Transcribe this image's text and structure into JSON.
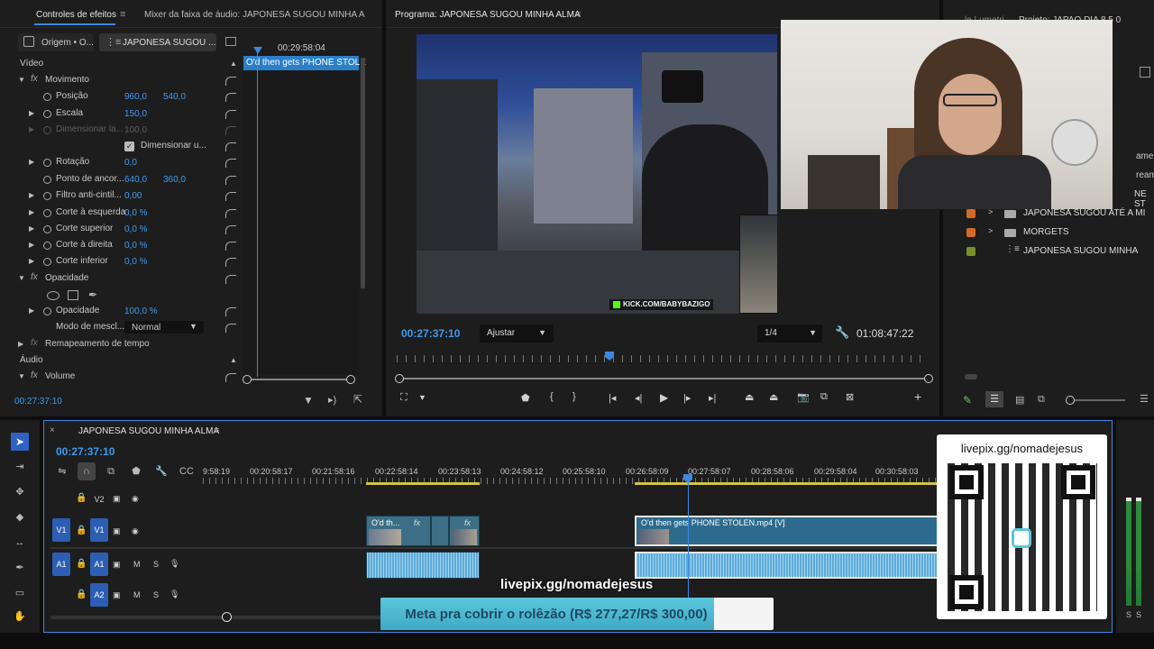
{
  "effects_panel": {
    "tab_effects": "Controles de efeitos",
    "tab_mixer": "Mixer da faixa de áudio: JAPONESA SUGOU MINHA ALMA",
    "source_tab": "Origem • O...",
    "sequence_tab": "JAPONESA SUGOU ...",
    "mini_timecode": "00:29:58:04",
    "mini_clip": "O'd then gets PHONE STOLE",
    "section_video": "Vídeo",
    "movimento": "Movimento",
    "posicao": "Posição",
    "posicao_x": "960,0",
    "posicao_y": "540,0",
    "escala": "Escala",
    "escala_v": "150,0",
    "dim_largura": "Dimensionar la...",
    "dim_largura_v": "100,0",
    "dim_uniforme": "Dimensionar u...",
    "rotacao": "Rotação",
    "rotacao_v": "0,0",
    "ancora": "Ponto de ancor...",
    "ancora_x": "640,0",
    "ancora_y": "360,0",
    "filtro": "Filtro anti-cintil...",
    "filtro_v": "0,00",
    "corte_esq": "Corte à esquerda",
    "corte_esq_v": "0,0 %",
    "corte_sup": "Corte superior",
    "corte_sup_v": "0,0 %",
    "corte_dir": "Corte à direita",
    "corte_dir_v": "0,0 %",
    "corte_inf": "Corte inferior",
    "corte_inf_v": "0,0 %",
    "opacidade_fx": "Opacidade",
    "opacidade": "Opacidade",
    "opacidade_v": "100,0 %",
    "modo": "Modo de mescl...",
    "modo_v": "Normal",
    "remap": "Remapeamento de tempo",
    "section_audio": "Áudio",
    "volume": "Volume",
    "timecode": "00:27:37:10"
  },
  "program": {
    "title": "Programa: JAPONESA SUGOU MINHA ALMA",
    "timecode": "00:27:37:10",
    "fit": "Ajustar",
    "resolution": "1/4",
    "duration": "01:08:47:22",
    "video_overlay_text": "KICK.COM/BABYBAZIGO"
  },
  "project": {
    "tab_lumetri": "le Lumetri",
    "tab_project": "Projeto: JAPAO DIA 8 5 0",
    "partial_items": [
      "amer",
      "ream",
      "NE ST"
    ],
    "items": [
      {
        "label": "JAPONESA SUGOU ATÉ A MI",
        "color": "#d46a28",
        "type": "folder"
      },
      {
        "label": "MORGETS",
        "color": "#d46a28",
        "type": "folder"
      },
      {
        "label": "JAPONESA SUGOU MINHA",
        "color": "#7a8f2c",
        "type": "sequence"
      }
    ]
  },
  "timeline": {
    "tab": "JAPONESA SUGOU MINHA ALMA",
    "timecode": "00:27:37:10",
    "ruler": [
      "9:58:19",
      "00:20:58:17",
      "00:21:58:16",
      "00:22:58:14",
      "00:23:58:13",
      "00:24:58:12",
      "00:25:58:10",
      "00:26:58:09",
      "00:27:58:07",
      "00:28:58:06",
      "00:29:58:04",
      "00:30:58:03"
    ],
    "tracks": {
      "v2": "V2",
      "v1": "V1",
      "a1": "A1",
      "a2": "A2",
      "v1_src": "V1",
      "a1_src": "A1",
      "m": "M",
      "s": "S"
    },
    "clip_a": "O'd th...",
    "clip_fx": "fx",
    "clip_b": "O'd then gets PHONE STOLEN.mp4 [V]"
  },
  "overlay": {
    "qr_url": "livepix.gg/nomadejesus",
    "url": "livepix.gg/nomadejesus",
    "goal_bar": "Meta pra cobrir o rolêzão (R$ 277,27/R$ 300,00)",
    "goal_progress": 0.924
  },
  "audio_meter": {
    "s1": "S",
    "s2": "S"
  }
}
